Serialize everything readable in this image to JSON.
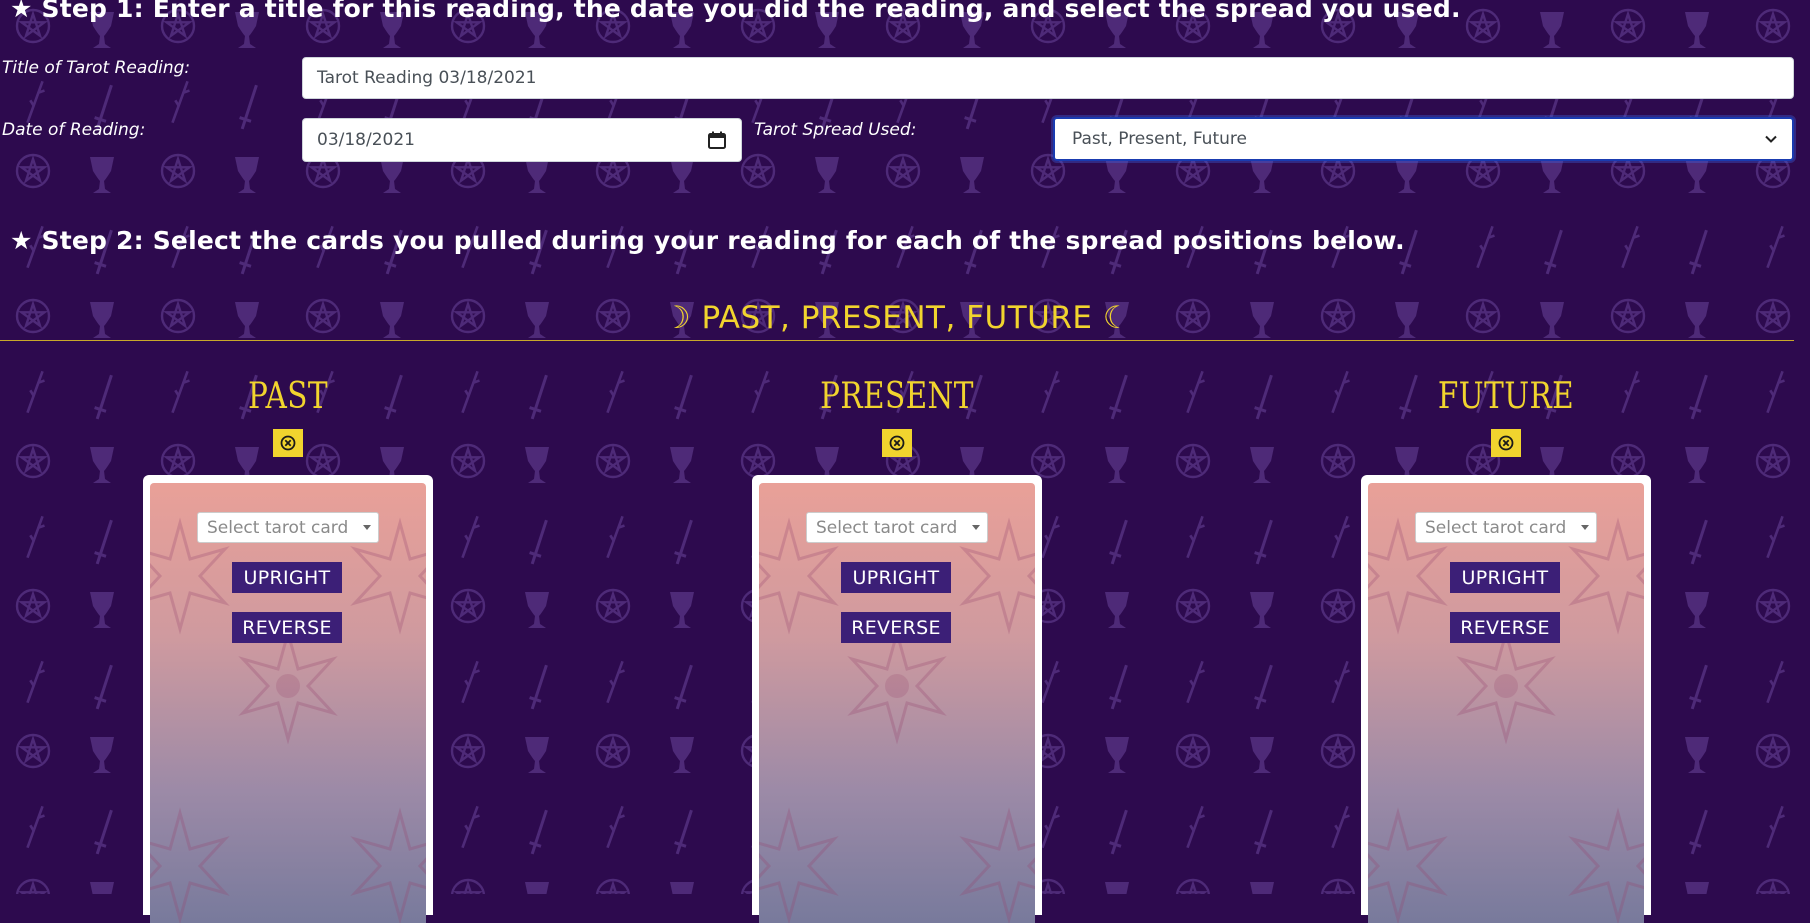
{
  "colors": {
    "background": "#2d0a4e",
    "pattern": "#4e2a78",
    "accent": "#f1d42e",
    "button": "#3c1f77",
    "card_top": "#e9a098",
    "card_bottom": "#787a9c"
  },
  "step1": {
    "heading": "★ Step 1: Enter a title for this reading, the date you did the reading, and select the spread you used.",
    "title_label": "Title of Tarot Reading:",
    "title_value": "Tarot Reading 03/18/2021",
    "date_label": "Date of Reading:",
    "date_value": "03/18/2021",
    "spread_label": "Tarot Spread Used:",
    "spread_value": "Past, Present, Future"
  },
  "step2": {
    "heading": "★ Step 2: Select the cards you pulled during your reading for each of the spread positions below."
  },
  "spread": {
    "title": "☽ PAST, PRESENT, FUTURE ☾",
    "positions": [
      {
        "title": "PAST",
        "select_placeholder": "Select tarot card",
        "upright_label": "UPRIGHT",
        "reverse_label": "REVERSE"
      },
      {
        "title": "PRESENT",
        "select_placeholder": "Select tarot card",
        "upright_label": "UPRIGHT",
        "reverse_label": "REVERSE"
      },
      {
        "title": "FUTURE",
        "select_placeholder": "Select tarot card",
        "upright_label": "UPRIGHT",
        "reverse_label": "REVERSE"
      }
    ]
  },
  "icons": {
    "background_motifs": [
      "pentacle-icon",
      "chalice-icon",
      "wand-icon",
      "sword-icon"
    ],
    "date_picker": "calendar-icon",
    "select": "chevron-down-icon",
    "clear": "close-circle-icon"
  }
}
